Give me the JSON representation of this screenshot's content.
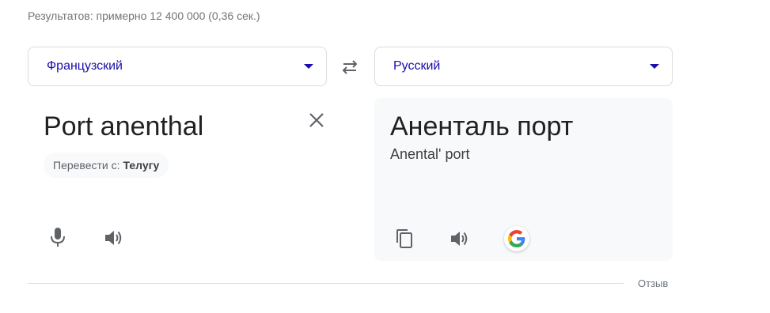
{
  "results_stats": "Результатов: примерно 12 400 000 (0,36 сек.)",
  "source_language": "Французский",
  "target_language": "Русский",
  "source": {
    "text": "Port anenthal",
    "detect_prefix": "Перевести с:",
    "detect_language": "Телугу"
  },
  "target": {
    "text": "Аненталь порт",
    "transliteration": "Anental' port"
  },
  "feedback": "Отзыв",
  "icons": {
    "swap": "swap-icon",
    "clear": "close-icon",
    "mic": "microphone-icon",
    "speaker": "speaker-icon",
    "copy": "copy-icon",
    "google": "google-logo-icon"
  },
  "colors": {
    "accent": "#1a0dab",
    "icon": "#5f6368",
    "panel_bg": "#f8f9fa"
  }
}
